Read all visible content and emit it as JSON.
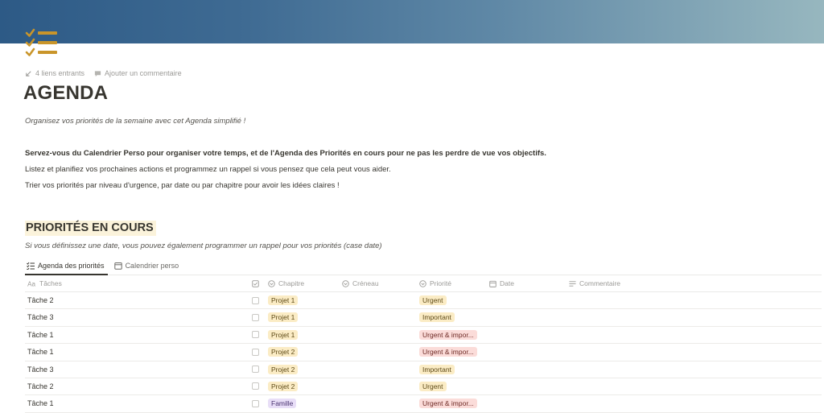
{
  "page": {
    "meta": {
      "backlinks_label": "4 liens entrants",
      "comment_label": "Ajouter un commentaire"
    },
    "title": "AGENDA",
    "subtitle": "Organisez vos priorités de la semaine avec cet Agenda simplifié !",
    "paragraphs": [
      "Servez-vous du Calendrier Perso pour organiser votre temps, et de l'Agenda des Priorités en cours pour ne pas les perdre de vue vos objectifs.",
      "Listez et planifiez vos prochaines actions et programmez un rappel si vous pensez que cela peut vous aider.",
      "Trier vos priorités par niveau d'urgence, par date ou par chapitre pour avoir les idées claires !"
    ]
  },
  "section": {
    "title": "PRIORITÉS EN COURS",
    "note": "Si vous définissez une date, vous pouvez également programmer un rappel pour vos priorités (case date)"
  },
  "tabs": [
    {
      "label": "Agenda des priorités",
      "icon": "list-check-icon",
      "active": true
    },
    {
      "label": "Calendrier perso",
      "icon": "calendar-icon",
      "active": false
    }
  ],
  "table": {
    "columns": {
      "task": "Tâches",
      "chapter": "Chapitre",
      "slot": "Créneau",
      "priority": "Priorité",
      "date": "Date",
      "comment": "Commentaire"
    },
    "rows": [
      {
        "task": "Tâche 2",
        "done": false,
        "chapter": "Projet 1",
        "chapter_color": "yellow",
        "priority": "Urgent",
        "priority_color": "yellow"
      },
      {
        "task": "Tâche 3",
        "done": false,
        "chapter": "Projet 1",
        "chapter_color": "yellow",
        "priority": "Important",
        "priority_color": "yellow"
      },
      {
        "task": "Tâche 1",
        "done": false,
        "chapter": "Projet 1",
        "chapter_color": "yellow",
        "priority": "Urgent & impor...",
        "priority_color": "red"
      },
      {
        "task": "Tâche 1",
        "done": false,
        "chapter": "Projet 2",
        "chapter_color": "yellow",
        "priority": "Urgent & impor...",
        "priority_color": "red"
      },
      {
        "task": "Tâche 3",
        "done": false,
        "chapter": "Projet 2",
        "chapter_color": "yellow",
        "priority": "Important",
        "priority_color": "yellow"
      },
      {
        "task": "Tâche 2",
        "done": false,
        "chapter": "Projet 2",
        "chapter_color": "yellow",
        "priority": "Urgent",
        "priority_color": "yellow"
      },
      {
        "task": "Tâche 1",
        "done": false,
        "chapter": "Famille",
        "chapter_color": "purple",
        "priority": "Urgent & impor...",
        "priority_color": "red"
      }
    ]
  },
  "colors": {
    "accent_gold": "#c9952a",
    "tag_yellow": "#fbecc5",
    "tag_red": "#fbdcd9",
    "tag_purple": "#e8def7",
    "section_highlight": "#fbf3db"
  }
}
